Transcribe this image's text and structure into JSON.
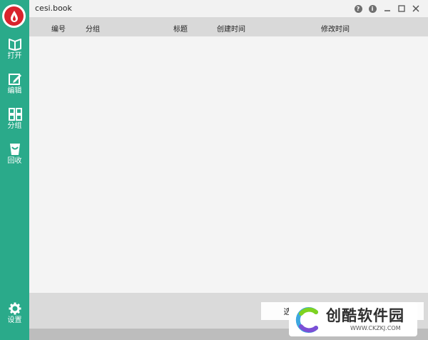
{
  "window": {
    "title": "cesi.book",
    "controls": [
      {
        "name": "help-icon",
        "glyph": "?"
      },
      {
        "name": "info-icon",
        "glyph": "i"
      },
      {
        "name": "minimize-icon"
      },
      {
        "name": "maximize-icon"
      },
      {
        "name": "close-icon"
      }
    ]
  },
  "sidebar": {
    "logo": "drop-logo-icon",
    "items": [
      {
        "label": "打开",
        "icon": "open-book-icon"
      },
      {
        "label": "编辑",
        "icon": "edit-icon"
      },
      {
        "label": "分组",
        "icon": "grid-icon"
      },
      {
        "label": "回收",
        "icon": "recycle-bin-icon"
      }
    ],
    "settings": {
      "label": "设置",
      "icon": "gear-icon"
    }
  },
  "table": {
    "columns": [
      "编号",
      "分组",
      "标题",
      "创建时间",
      "修改时间"
    ],
    "rows": []
  },
  "footer": {
    "buttons": [
      "选",
      "",
      ""
    ]
  },
  "watermark": {
    "title": "创酷软件园",
    "url": "WWW.CKZKJ.COM"
  },
  "colors": {
    "sidebar": "#2aaa8a",
    "logo_red": "#d9232d",
    "header_bg": "#d9d9d9",
    "footer_bg": "#dadada"
  }
}
